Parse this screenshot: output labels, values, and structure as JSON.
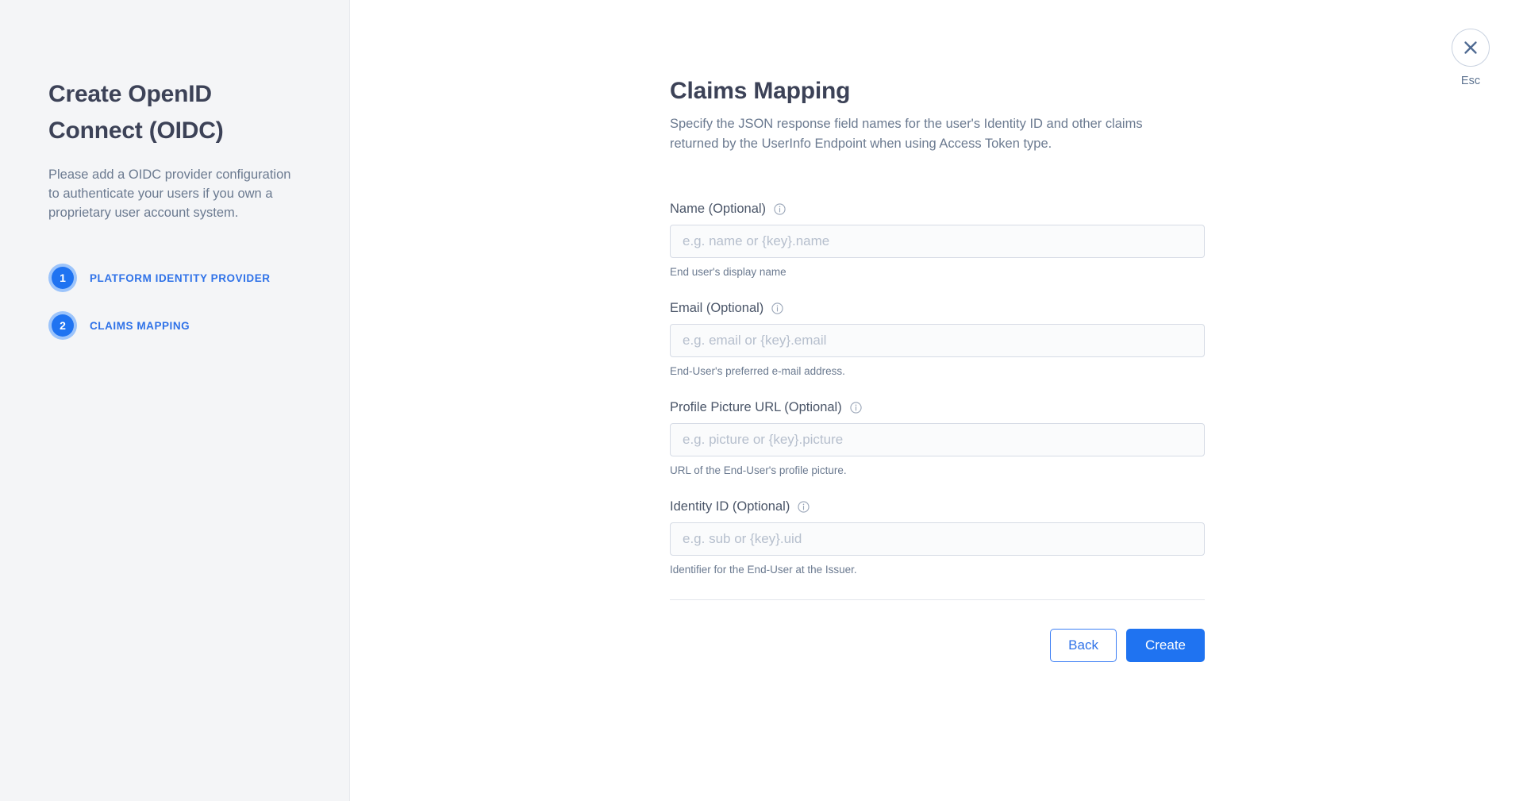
{
  "sidebar": {
    "title": "Create OpenID Connect (OIDC)",
    "description": "Please add a OIDC provider configuration to authenticate your users if you own a proprietary user account system.",
    "steps": [
      {
        "number": "1",
        "label": "PLATFORM IDENTITY PROVIDER"
      },
      {
        "number": "2",
        "label": "CLAIMS MAPPING"
      }
    ]
  },
  "panel": {
    "title": "Claims Mapping",
    "subtitle": "Specify the JSON response field names for the user's Identity ID and other claims returned by the UserInfo Endpoint when using Access Token type."
  },
  "fields": [
    {
      "label": "Name (Optional)",
      "info_icon": "info-circle-icon",
      "value": "",
      "placeholder": "e.g. name or {key}.name",
      "help": "End user's display name"
    },
    {
      "label": "Email (Optional)",
      "info_icon": "info-circle-icon",
      "value": "",
      "placeholder": "e.g. email or {key}.email",
      "help": "End-User's preferred e-mail address."
    },
    {
      "label": "Profile Picture URL (Optional)",
      "info_icon": "info-circle-icon",
      "value": "",
      "placeholder": "e.g. picture or {key}.picture",
      "help": "URL of the End-User's profile picture."
    },
    {
      "label": "Identity ID (Optional)",
      "info_icon": "info-circle-icon",
      "value": "",
      "placeholder": "e.g. sub or {key}.uid",
      "help": "Identifier for the End-User at the Issuer."
    }
  ],
  "actions": {
    "back_label": "Back",
    "create_label": "Create"
  },
  "close": {
    "icon": "close-x-icon",
    "esc_label": "Esc"
  },
  "colors": {
    "accent": "#1f73f1",
    "accent_text": "#2f72e8",
    "sidebar_bg": "#f4f5f7",
    "heading": "#3c4257",
    "muted_text": "#6b7a90",
    "input_bg": "#fafbfc",
    "input_border": "#d6dbe5"
  }
}
